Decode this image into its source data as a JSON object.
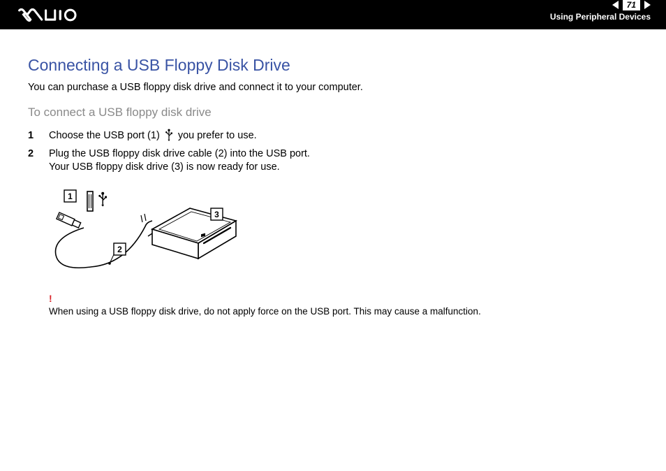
{
  "header": {
    "page_number": "71",
    "section": "Using Peripheral Devices"
  },
  "title": "Connecting a USB Floppy Disk Drive",
  "intro": "You can purchase a USB floppy disk drive and connect it to your computer.",
  "subtitle": "To connect a USB floppy disk drive",
  "steps": [
    {
      "num": "1",
      "text_pre": "Choose the USB port (1) ",
      "text_post": " you prefer to use."
    },
    {
      "num": "2",
      "line1": "Plug the USB floppy disk drive cable (2) into the USB port.",
      "line2": "Your USB floppy disk drive (3) is now ready for use."
    }
  ],
  "diagram": {
    "label1": "1",
    "label2": "2",
    "label3": "3"
  },
  "warning": {
    "mark": "!",
    "text": "When using a USB floppy disk drive, do not apply force on the USB port. This may cause a malfunction."
  }
}
